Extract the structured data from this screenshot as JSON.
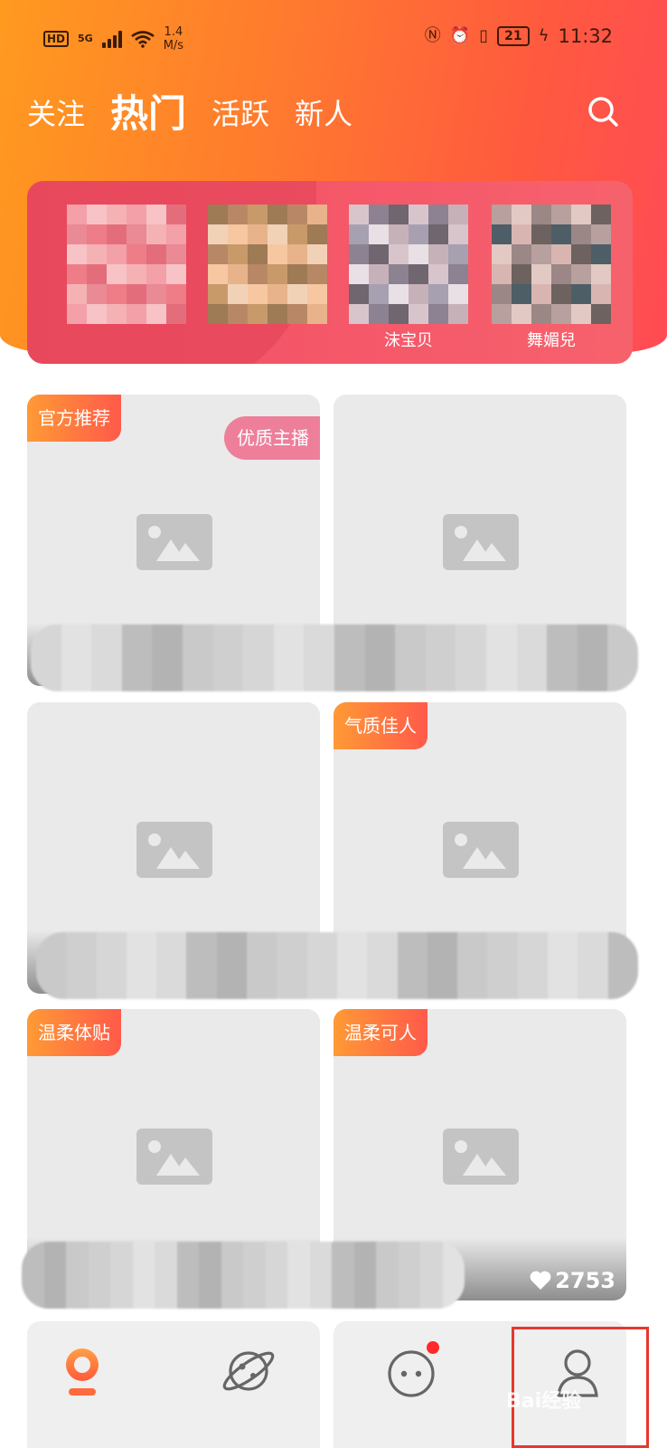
{
  "status_bar": {
    "hd": "HD",
    "network": "5G",
    "speed_value": "1.4",
    "speed_unit": "M/s",
    "battery": "21",
    "time": "11:32"
  },
  "top_tabs": [
    "关注",
    "热门",
    "活跃",
    "新人"
  ],
  "active_tab": "热门",
  "banner": {
    "names": [
      "",
      "",
      "沫宝贝",
      "舞媚兒"
    ]
  },
  "cards": [
    {
      "tag": "官方推荐",
      "badge": "优质主播"
    },
    {
      "tag": ""
    },
    {
      "tag": ""
    },
    {
      "tag": "气质佳人"
    },
    {
      "tag": "温柔体贴"
    },
    {
      "tag": "温柔可人",
      "likes": "2753"
    }
  ],
  "watermark": "Bai经验",
  "icons": {
    "search": "search-icon",
    "home": "home-icon",
    "discover": "planet-icon",
    "messages": "chat-icon",
    "profile": "user-icon",
    "placeholder": "image-placeholder-icon",
    "heart": "heart-icon"
  },
  "colors": {
    "header_start": "#ff9a1f",
    "header_end": "#ff4b55",
    "tag": "#ff7a3c",
    "badge": "#ee7f9b",
    "highlight": "#e8372e"
  }
}
